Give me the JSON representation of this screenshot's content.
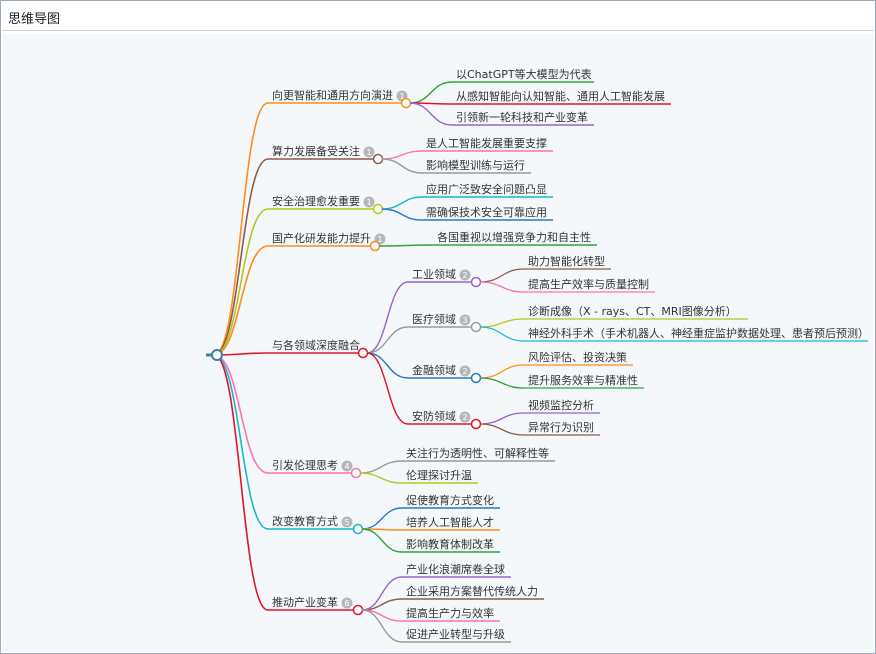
{
  "window": {
    "title": "思维导图"
  },
  "colors": {
    "canvas": "#f5f8fb",
    "badge": "#b7b7b7"
  },
  "mindmap": {
    "branches": [
      {
        "label": "向更智能和通用方向演进",
        "count": "1",
        "color": "#ff8c1a",
        "children": [
          {
            "label": "以ChatGPT等大模型为代表",
            "color": "#2da53c"
          },
          {
            "label": "从感知智能向认知智能、通用人工智能发展",
            "color": "#e0142c"
          },
          {
            "label": "引领新一轮科技和产业变革",
            "color": "#9a63c8"
          }
        ]
      },
      {
        "label": "算力发展备受关注",
        "count": "1",
        "color": "#8b5a4a",
        "children": [
          {
            "label": "是人工智能发展重要支撑",
            "color": "#ff6fb4"
          },
          {
            "label": "影响模型训练与运行",
            "color": "#9a9a9a"
          }
        ]
      },
      {
        "label": "安全治理愈发重要",
        "count": "1",
        "color": "#b5c61c",
        "children": [
          {
            "label": "应用广泛致安全问题凸显",
            "color": "#17b8c8"
          },
          {
            "label": "需确保技术安全可靠应用",
            "color": "#2778c8"
          }
        ]
      },
      {
        "label": "国产化研发能力提升",
        "count": "1",
        "color": "#ff8c1a",
        "children": [
          {
            "label": "各国重视以增强竞争力和自主性",
            "color": "#2da53c"
          }
        ]
      },
      {
        "label": "与各领域深度融合",
        "count": "",
        "color": "#e0142c",
        "children": [
          {
            "label": "工业领域",
            "count": "2",
            "color": "#9a63c8",
            "children": [
              {
                "label": "助力智能化转型",
                "color": "#8b5a4a"
              },
              {
                "label": "提高生产效率与质量控制",
                "color": "#ff6fb4"
              }
            ]
          },
          {
            "label": "医疗领域",
            "count": "3",
            "color": "#9a9a9a",
            "children": [
              {
                "label": "诊断成像（X - rays、CT、MRI图像分析）",
                "color": "#b5c61c"
              },
              {
                "label": "神经外科手术（手术机器人、神经重症监护数据处理、患者预后预测）",
                "color": "#17b8c8"
              }
            ]
          },
          {
            "label": "金融领域",
            "count": "2",
            "color": "#2778c8",
            "children": [
              {
                "label": "风险评估、投资决策",
                "color": "#ff8c1a"
              },
              {
                "label": "提升服务效率与精准性",
                "color": "#2da53c"
              }
            ]
          },
          {
            "label": "安防领域",
            "count": "2",
            "color": "#e0142c",
            "children": [
              {
                "label": "视频监控分析",
                "color": "#9a63c8"
              },
              {
                "label": "异常行为识别",
                "color": "#8b5a4a"
              }
            ]
          }
        ]
      },
      {
        "label": "引发伦理思考",
        "count": "4",
        "color": "#ff6fb4",
        "children": [
          {
            "label": "关注行为透明性、可解释性等",
            "color": "#9a9a9a"
          },
          {
            "label": "伦理探讨升温",
            "color": "#b5c61c"
          }
        ]
      },
      {
        "label": "改变教育方式",
        "count": "5",
        "color": "#17b8c8",
        "children": [
          {
            "label": "促使教育方式变化",
            "color": "#2778c8"
          },
          {
            "label": "培养人工智能人才",
            "color": "#ff8c1a"
          },
          {
            "label": "影响教育体制改革",
            "color": "#2da53c"
          }
        ]
      },
      {
        "label": "推动产业变革",
        "count": "6",
        "color": "#e0142c",
        "children": [
          {
            "label": "产业化浪潮席卷全球",
            "color": "#9a63c8"
          },
          {
            "label": "企业采用方案替代传统人力",
            "color": "#8b5a4a"
          },
          {
            "label": "提高生产力与效率",
            "color": "#ff6fb4"
          },
          {
            "label": "促进产业转型与升级",
            "color": "#9a9a9a"
          }
        ]
      }
    ]
  }
}
